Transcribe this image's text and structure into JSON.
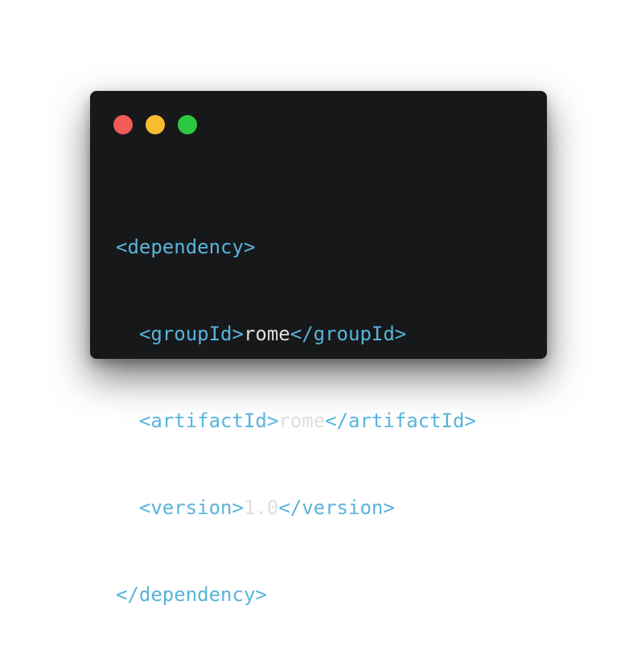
{
  "window": {
    "controls": [
      {
        "name": "close",
        "color": "#f05a57"
      },
      {
        "name": "minimize",
        "color": "#f8bc31"
      },
      {
        "name": "maximize",
        "color": "#2bc840"
      }
    ]
  },
  "code": {
    "colors": {
      "tag": "#58b4dc",
      "text": "#dedede",
      "background": "#17181a"
    },
    "lines": [
      {
        "indent": "",
        "open": "<dependency>",
        "value": "",
        "close": ""
      },
      {
        "indent": "  ",
        "open": "<groupId>",
        "value": "rome",
        "close": "</groupId>"
      },
      {
        "indent": "  ",
        "open": "<artifactId>",
        "value": "rome",
        "close": "</artifactId>"
      },
      {
        "indent": "  ",
        "open": "<version>",
        "value": "1.0",
        "close": "</version>"
      },
      {
        "indent": "",
        "open": "</dependency>",
        "value": "",
        "close": ""
      }
    ]
  }
}
